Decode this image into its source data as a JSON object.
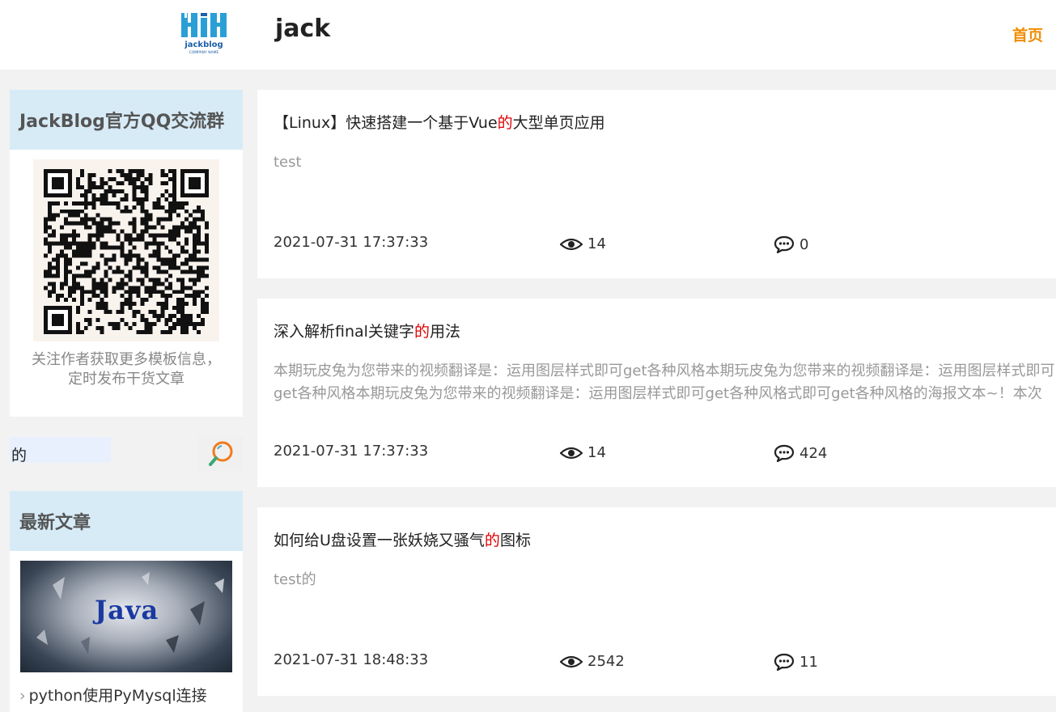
{
  "header": {
    "logo_text": "jackblog",
    "logo_subtext": "COMPANY NAME",
    "site_name": "jack",
    "nav_home": "首页"
  },
  "sidebar": {
    "qq_group": {
      "title": "JackBlog官方QQ交流群",
      "description": "关注作者获取更多模板信息，定时发布干货文章"
    },
    "search": {
      "value": "的"
    },
    "latest": {
      "title": "最新文章",
      "thumb_text": "Java",
      "items": [
        {
          "label": "python使用PyMysql连接"
        }
      ]
    }
  },
  "articles": [
    {
      "title_pre": "【Linux】快速搭建一个基于Vue",
      "title_hl": "的",
      "title_post": "大型单页应用",
      "summary": "test",
      "date": "2021-07-31 17:37:33",
      "views": "14",
      "comments": "0"
    },
    {
      "title_pre": "深入解析final关键字",
      "title_hl": "的",
      "title_post": "用法",
      "summary": "本期玩皮兔为您带来的视频翻译是：运用图层样式即可get各种风格本期玩皮兔为您带来的视频翻译是：运用图层样式即可get各种风格本期玩皮兔为您带来的视频翻译是：运用图层样式即可get各种风格式即可get各种风格的海报文本~！本次教程",
      "date": "2021-07-31 17:37:33",
      "views": "14",
      "comments": "424"
    },
    {
      "title_pre": "如何给U盘设置一张妖娆又骚气",
      "title_hl": "的",
      "title_post": "图标",
      "summary": "test的",
      "date": "2021-07-31 18:48:33",
      "views": "2542",
      "comments": "11"
    }
  ],
  "colors": {
    "accent": "#f08c00",
    "highlight": "#e00000",
    "card_head": "#d7ebf7"
  }
}
